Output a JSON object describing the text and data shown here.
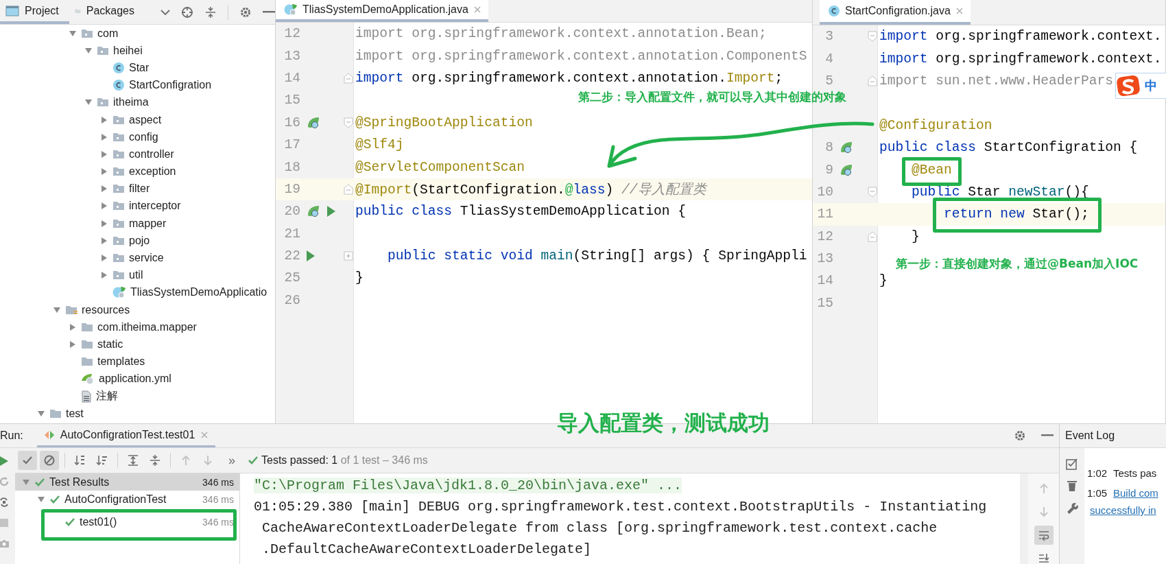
{
  "project_panel": {
    "tabs": [
      {
        "label": "Project",
        "selected": true
      },
      {
        "label": "Packages",
        "selected": false
      }
    ],
    "tree": [
      {
        "name": "com",
        "kind": "package",
        "expanded": true,
        "children": [
          {
            "name": "heihei",
            "kind": "package",
            "expanded": true,
            "children": [
              {
                "name": "Star",
                "kind": "class"
              },
              {
                "name": "StartConfigration",
                "kind": "class"
              }
            ]
          },
          {
            "name": "itheima",
            "kind": "package",
            "expanded": true,
            "children": [
              {
                "name": "aspect",
                "kind": "package",
                "expanded": false
              },
              {
                "name": "config",
                "kind": "package",
                "expanded": false
              },
              {
                "name": "controller",
                "kind": "package",
                "expanded": false
              },
              {
                "name": "exception",
                "kind": "package",
                "expanded": false
              },
              {
                "name": "filter",
                "kind": "package",
                "expanded": false
              },
              {
                "name": "interceptor",
                "kind": "package",
                "expanded": false
              },
              {
                "name": "mapper",
                "kind": "package",
                "expanded": false
              },
              {
                "name": "pojo",
                "kind": "package",
                "expanded": false
              },
              {
                "name": "service",
                "kind": "package",
                "expanded": false
              },
              {
                "name": "util",
                "kind": "package",
                "expanded": false
              },
              {
                "name": "TliasSystemDemoApplicatio",
                "kind": "spring-class"
              }
            ]
          }
        ]
      },
      {
        "name": "resources",
        "kind": "resource-folder",
        "expanded": true,
        "children": [
          {
            "name": "com.itheima.mapper",
            "kind": "folder",
            "expanded": false
          },
          {
            "name": "static",
            "kind": "folder",
            "expanded": false
          },
          {
            "name": "templates",
            "kind": "folder"
          },
          {
            "name": "application.yml",
            "kind": "yml"
          },
          {
            "name": "注解",
            "kind": "text"
          }
        ]
      },
      {
        "name": "test",
        "kind": "folder",
        "expanded": true
      }
    ]
  },
  "editors": [
    {
      "tab": {
        "label": "TliasSystemDemoApplication.java",
        "kind": "spring-class",
        "selected": true
      },
      "lines": [
        {
          "number": "12",
          "current": false,
          "tokens": [
            {
              "kind": "gray",
              "text": "import org.springframework.context.annotation.Bean;"
            }
          ]
        },
        {
          "number": "13",
          "current": false,
          "tokens": [
            {
              "kind": "gray",
              "text": "import org.springframework.context.annotation.ComponentS"
            }
          ]
        },
        {
          "number": "14",
          "current": false,
          "fold": {
            "kind": "end"
          },
          "tokens": [
            {
              "kind": "kw",
              "text": "import"
            },
            {
              "kind": "plain",
              "text": " org.springframework.context.annotation."
            },
            {
              "kind": "annot",
              "text": "Import"
            },
            {
              "kind": "plain",
              "text": ";"
            }
          ]
        },
        {
          "number": "15",
          "current": false
        },
        {
          "number": "16",
          "current": false,
          "fold": {
            "kind": "start"
          },
          "gutter": [
            {
              "kind": "spring"
            }
          ],
          "tokens": [
            {
              "kind": "annot",
              "text": "@SpringBootApplication"
            }
          ]
        },
        {
          "number": "17",
          "current": false,
          "tokens": [
            {
              "kind": "annot",
              "text": "@Slf4j"
            }
          ]
        },
        {
          "number": "18",
          "current": false,
          "tokens": [
            {
              "kind": "annot",
              "text": "@ServletComponentScan"
            }
          ]
        },
        {
          "number": "19",
          "current": true,
          "fold": {
            "kind": "end"
          },
          "tokens": [
            {
              "kind": "annot",
              "text": "@Import"
            },
            {
              "kind": "plain",
              "text": "(StartConfigration."
            },
            {
              "kind": "mark",
              "text": "@"
            },
            {
              "kind": "kw",
              "text": "lass"
            },
            {
              "kind": "plain",
              "text": ") "
            },
            {
              "kind": "comment",
              "text": "//导入配置类"
            }
          ]
        },
        {
          "number": "20",
          "current": false,
          "gutter": [
            {
              "kind": "spring"
            },
            {
              "kind": "run"
            }
          ],
          "tokens": [
            {
              "kind": "kw",
              "text": "public class"
            },
            {
              "kind": "plain",
              "text": " TliasSystemDemoApplication {"
            }
          ]
        },
        {
          "number": "21",
          "current": false
        },
        {
          "number": "22",
          "current": false,
          "fold": {
            "kind": "collapsed"
          },
          "gutter": [
            {
              "kind": "run"
            }
          ],
          "tokens": [
            {
              "kind": "kw",
              "text": "    public static void"
            },
            {
              "kind": "method",
              "text": " main"
            },
            {
              "kind": "plain",
              "text": "(String[] args) { SpringAppli"
            }
          ]
        },
        {
          "number": "25",
          "current": false,
          "tokens": [
            {
              "kind": "plain",
              "text": "}"
            }
          ]
        },
        {
          "number": "26",
          "current": false
        }
      ]
    },
    {
      "tab": {
        "label": "StartConfigration.java",
        "kind": "class",
        "selected": true
      },
      "lines": [
        {
          "number": "3",
          "current": false,
          "fold": {
            "kind": "start"
          },
          "tokens": [
            {
              "kind": "kw",
              "text": "import"
            },
            {
              "kind": "plain",
              "text": " org.springframework.context."
            }
          ]
        },
        {
          "number": "4",
          "current": false,
          "tokens": [
            {
              "kind": "kw",
              "text": "import"
            },
            {
              "kind": "plain",
              "text": " org.springframework.context."
            }
          ]
        },
        {
          "number": "5",
          "current": false,
          "fold": {
            "kind": "end"
          },
          "tokens": [
            {
              "kind": "gray",
              "text": "import sun.net.www.HeaderPars"
            }
          ]
        },
        {
          "current": false
        },
        {
          "current": false,
          "tokens": [
            {
              "kind": "annot",
              "text": "@Configuration"
            }
          ]
        },
        {
          "number": "8",
          "current": false,
          "gutter": [
            {
              "kind": "spring"
            }
          ],
          "tokens": [
            {
              "kind": "kw",
              "text": "public class"
            },
            {
              "kind": "plain",
              "text": " StartConfigration {"
            }
          ]
        },
        {
          "number": "9",
          "current": false,
          "gutter": [
            {
              "kind": "spring"
            }
          ],
          "tokens": [
            {
              "kind": "annot",
              "text": "    @Bean"
            }
          ]
        },
        {
          "number": "10",
          "current": false,
          "fold": {
            "kind": "start"
          },
          "tokens": [
            {
              "kind": "kw",
              "text": "    public"
            },
            {
              "kind": "plain",
              "text": " Star "
            },
            {
              "kind": "method",
              "text": "newStar"
            },
            {
              "kind": "plain",
              "text": "(){"
            }
          ]
        },
        {
          "number": "11",
          "current": true,
          "tokens": [
            {
              "kind": "kw",
              "text": "        return new"
            },
            {
              "kind": "plain",
              "text": " Star();"
            }
          ]
        },
        {
          "number": "12",
          "current": false,
          "fold": {
            "kind": "end"
          },
          "tokens": [
            {
              "kind": "plain",
              "text": "    }"
            }
          ]
        },
        {
          "number": "13",
          "current": false
        },
        {
          "number": "14",
          "current": false,
          "tokens": [
            {
              "kind": "plain",
              "text": "}"
            }
          ]
        },
        {
          "number": "15",
          "current": false
        }
      ]
    }
  ],
  "ime_badge": {
    "label": "中"
  },
  "annotations": {
    "step_two": "第二步：导入配置文件，就可以导入其中创建的对象",
    "step_one": "第一步：直接创建对象，通过@Bean加入IOC",
    "result": "导入配置类，测试成功"
  },
  "run_panel": {
    "label": "Run:",
    "tab": {
      "label": "AutoConfigrationTest.test01",
      "selected": true
    },
    "side_tools": [
      {
        "kind": "run"
      },
      {
        "kind": "rerun"
      },
      {
        "kind": "toggle"
      },
      {
        "kind": "stop"
      },
      {
        "kind": "camera"
      }
    ],
    "toolbar": [
      {
        "kind": "show-passed",
        "on": true
      },
      {
        "kind": "show-ignored",
        "on": true
      },
      {
        "kind": "sort-alpha"
      },
      {
        "kind": "sort-duration"
      },
      {
        "kind": "expand-all"
      },
      {
        "kind": "collapse-all"
      },
      {
        "kind": "previous"
      },
      {
        "kind": "next"
      }
    ],
    "more": "»",
    "status": {
      "passed": "Tests passed: 1",
      "detail": " of 1 test – 346 ms"
    },
    "results": [
      {
        "name": "Test Results",
        "time": "346 ms",
        "selected": true,
        "expanded": true,
        "children": [
          {
            "name": "AutoConfigrationTest",
            "time": "346 ms",
            "selected": false,
            "expanded": true,
            "children": [
              {
                "name": "test01()",
                "time": "346 ms",
                "selected": false
              }
            ]
          }
        ]
      }
    ],
    "console": [
      {
        "kind": "command",
        "text": "\"C:\\Program Files\\Java\\jdk1.8.0_20\\bin\\java.exe\" ..."
      },
      {
        "kind": "log",
        "text": "01:05:29.380 [main] DEBUG org.springframework.test.context.BootstrapUtils - Instantiating"
      },
      {
        "kind": "log",
        "text": " CacheAwareContextLoaderDelegate from class [org.springframework.test.context.cache"
      },
      {
        "kind": "log",
        "text": " .DefaultCacheAwareContextLoaderDelegate]"
      }
    ],
    "console_tools": [
      {
        "kind": "up"
      },
      {
        "kind": "down"
      },
      {
        "kind": "wrap",
        "on": true
      },
      {
        "kind": "scroll-end"
      }
    ]
  },
  "event_log": {
    "title": "Event Log",
    "entries": [
      {
        "time": "1:02",
        "kind": "text",
        "lines": [
          "Tests pas"
        ]
      },
      {
        "time": "1:05",
        "kind": "link",
        "lines": [
          "Build com",
          "successfully in"
        ]
      }
    ]
  }
}
